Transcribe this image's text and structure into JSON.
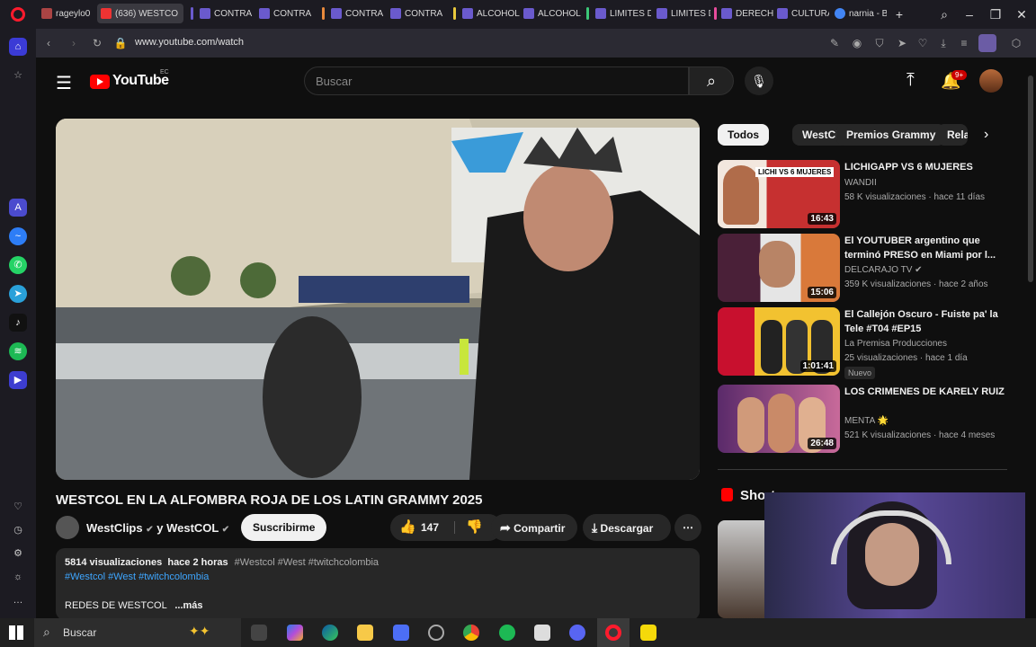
{
  "browser": {
    "tabs": [
      {
        "label": "rageylo0",
        "color": "#a44"
      },
      {
        "label": "(636) WESTCO",
        "color": "#e33"
      },
      {
        "label": "CONTRA",
        "color": "#6a5acd"
      },
      {
        "label": "CONTRA",
        "color": "#6a5acd"
      },
      {
        "label": "CONTRA",
        "color": "#6a5acd"
      },
      {
        "label": "CONTRA",
        "color": "#6a5acd"
      },
      {
        "label": "ALCOHOL",
        "color": "#6a5acd"
      },
      {
        "label": "ALCOHOL",
        "color": "#6a5acd"
      },
      {
        "label": "LIMITES D",
        "color": "#6a5acd"
      },
      {
        "label": "LIMITES D",
        "color": "#6a5acd"
      },
      {
        "label": "DERECHO",
        "color": "#6a5acd"
      },
      {
        "label": "CULTURA",
        "color": "#6a5acd"
      },
      {
        "label": "narnia - B",
        "color": "#4285f4"
      }
    ],
    "url": "www.youtube.com/watch"
  },
  "youtube": {
    "logo_text": "YouTube",
    "country": "EC",
    "search_placeholder": "Buscar",
    "notif_count": "9+",
    "video_title": "WESTCOL EN LA ALFOMBRA ROJA DE LOS LATIN GRAMMY 2025",
    "channel_text": "WestClips",
    "collab_text": "y WestCOL",
    "subscribe_label": "Suscribirme",
    "likes": "147",
    "share_label": "Compartir",
    "download_label": "Descargar",
    "desc_stats": "5814 visualizaciones  hace 2 horas",
    "desc_tags": "#Westcol #West #twitchcolombia",
    "desc_tags_line": "#Westcol #West #twitchcolombia",
    "desc_more_left": "REDES DE WESTCOL",
    "desc_more": "...más",
    "shorts_label": "Shorts",
    "chips": [
      "Todos",
      "WestClips",
      "Premios Grammy",
      "Rela"
    ],
    "related": [
      {
        "title": "LICHIGAPP VS 6 MUJERES",
        "channel": "WANDII",
        "meta": "58 K visualizaciones · hace 11 días",
        "duration": "16:43",
        "overlay": "LICHI VS 6 MUJERES"
      },
      {
        "title": "El YOUTUBER argentino que terminó PRESO en Miami por l...",
        "channel": "DELCARAJO TV",
        "meta": "359 K visualizaciones · hace 2 años",
        "duration": "15:06"
      },
      {
        "title": "El Callejón Oscuro - Fuiste pa' la Tele #T04 #EP15",
        "channel": "La Premisa Producciones",
        "meta": "25 visualizaciones · hace 1 día",
        "duration": "1:01:41",
        "badge": "Nuevo"
      },
      {
        "title": "LOS CRIMENES DE KARELY RUIZ",
        "channel": "MENTA 🌟",
        "meta": "521 K visualizaciones · hace 4 meses",
        "duration": "26:48"
      }
    ]
  },
  "taskbar": {
    "search_label": "Buscar"
  }
}
